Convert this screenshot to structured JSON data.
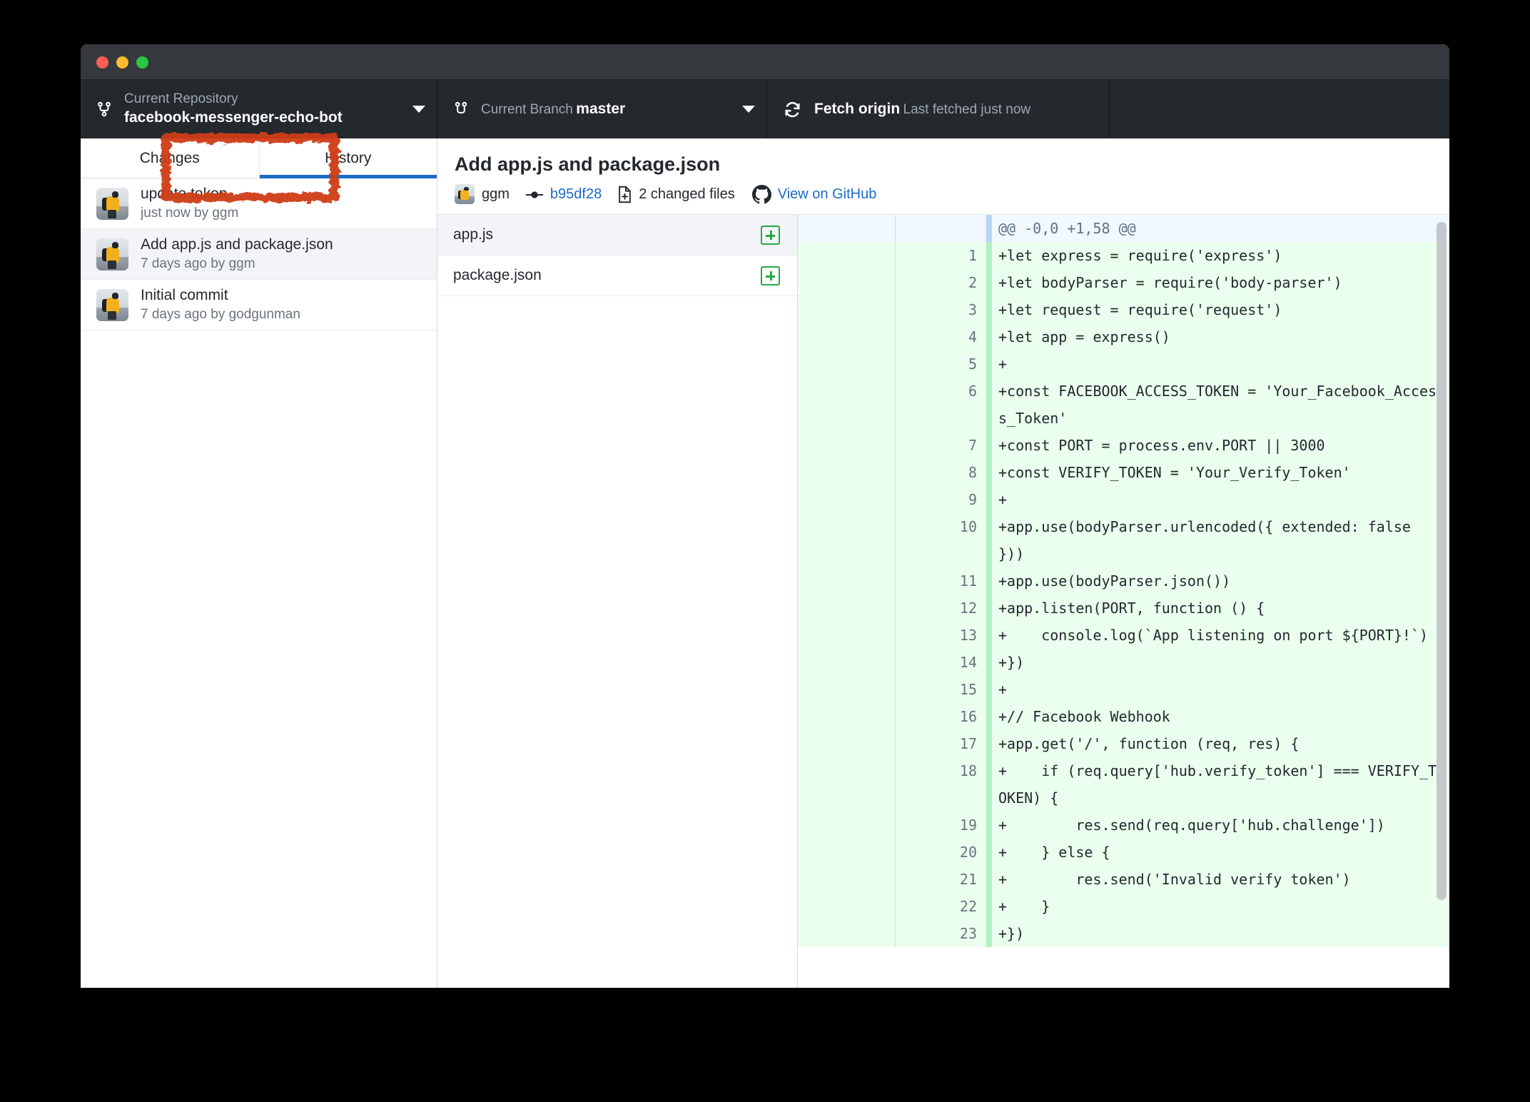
{
  "window": {
    "traffic_lights": [
      "close",
      "minimize",
      "maximize"
    ]
  },
  "toolbar": {
    "repository": {
      "label": "Current Repository",
      "value": "facebook-messenger-echo-bot",
      "icon": "repo-branch-icon"
    },
    "branch": {
      "label": "Current Branch",
      "value": "master",
      "icon": "branch-icon"
    },
    "fetch": {
      "label": "Fetch origin",
      "value": "Last fetched just now",
      "icon": "sync-icon"
    }
  },
  "sidebar": {
    "tabs": [
      {
        "label": "Changes",
        "active": false
      },
      {
        "label": "History",
        "active": true
      }
    ],
    "commits": [
      {
        "title": "update token",
        "meta": "just now by ggm",
        "selected": false
      },
      {
        "title": "Add app.js and package.json",
        "meta": "7 days ago by ggm",
        "selected": true
      },
      {
        "title": "Initial commit",
        "meta": "7 days ago by godgunman",
        "selected": false
      }
    ]
  },
  "commit_detail": {
    "title": "Add app.js and package.json",
    "author": "ggm",
    "sha": "b95df28",
    "changed_files": "2 changed files",
    "view_on_github": "View on GitHub"
  },
  "files": [
    {
      "name": "app.js",
      "status": "added",
      "selected": true
    },
    {
      "name": "package.json",
      "status": "added",
      "selected": false
    }
  ],
  "diff": {
    "rows": [
      {
        "type": "hunk",
        "old": "",
        "new": "",
        "code": "@@ -0,0 +1,58 @@"
      },
      {
        "type": "add",
        "old": "",
        "new": "1",
        "code": "+let express = require('express')"
      },
      {
        "type": "add",
        "old": "",
        "new": "2",
        "code": "+let bodyParser = require('body-parser')"
      },
      {
        "type": "add",
        "old": "",
        "new": "3",
        "code": "+let request = require('request')"
      },
      {
        "type": "add",
        "old": "",
        "new": "4",
        "code": "+let app = express()"
      },
      {
        "type": "add",
        "old": "",
        "new": "5",
        "code": "+"
      },
      {
        "type": "add",
        "old": "",
        "new": "6",
        "code": "+const FACEBOOK_ACCESS_TOKEN = 'Your_Facebook_Access_Token'"
      },
      {
        "type": "add",
        "old": "",
        "new": "7",
        "code": "+const PORT = process.env.PORT || 3000"
      },
      {
        "type": "add",
        "old": "",
        "new": "8",
        "code": "+const VERIFY_TOKEN = 'Your_Verify_Token'"
      },
      {
        "type": "add",
        "old": "",
        "new": "9",
        "code": "+"
      },
      {
        "type": "add",
        "old": "",
        "new": "10",
        "code": "+app.use(bodyParser.urlencoded({ extended: false }))"
      },
      {
        "type": "add",
        "old": "",
        "new": "11",
        "code": "+app.use(bodyParser.json())"
      },
      {
        "type": "add",
        "old": "",
        "new": "12",
        "code": "+app.listen(PORT, function () {"
      },
      {
        "type": "add",
        "old": "",
        "new": "13",
        "code": "+    console.log(`App listening on port ${PORT}!`)"
      },
      {
        "type": "add",
        "old": "",
        "new": "14",
        "code": "+})"
      },
      {
        "type": "add",
        "old": "",
        "new": "15",
        "code": "+"
      },
      {
        "type": "add",
        "old": "",
        "new": "16",
        "code": "+// Facebook Webhook"
      },
      {
        "type": "add",
        "old": "",
        "new": "17",
        "code": "+app.get('/', function (req, res) {"
      },
      {
        "type": "add",
        "old": "",
        "new": "18",
        "code": "+    if (req.query['hub.verify_token'] === VERIFY_TOKEN) {"
      },
      {
        "type": "add",
        "old": "",
        "new": "19",
        "code": "+        res.send(req.query['hub.challenge'])"
      },
      {
        "type": "add",
        "old": "",
        "new": "20",
        "code": "+    } else {"
      },
      {
        "type": "add",
        "old": "",
        "new": "21",
        "code": "+        res.send('Invalid verify token')"
      },
      {
        "type": "add",
        "old": "",
        "new": "22",
        "code": "+    }"
      },
      {
        "type": "add",
        "old": "",
        "new": "23",
        "code": "+})"
      }
    ]
  },
  "annotation": {
    "shape": "rectangle",
    "color": "#cf3d15",
    "target": "History tab"
  }
}
